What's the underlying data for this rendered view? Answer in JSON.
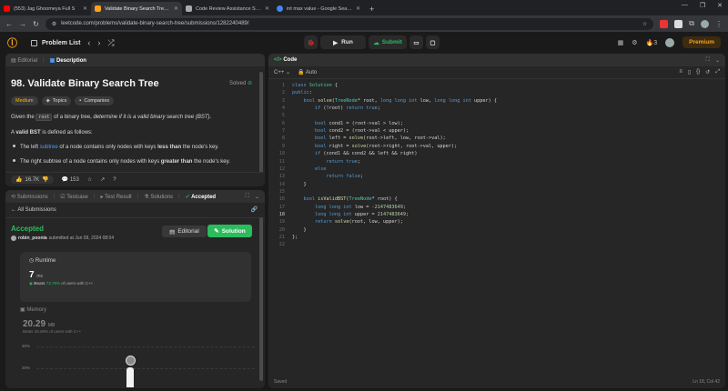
{
  "browser": {
    "tabs": [
      {
        "title": "(553) Jag Ghoomeya Full S",
        "color": "#ff0000"
      },
      {
        "title": "Validate Binary Search Tree - Le",
        "color": "#ffa116"
      },
      {
        "title": "Code Review Assistance System",
        "color": "#aaaaaa"
      },
      {
        "title": "int max value - Google Search",
        "color": "#4285f4"
      }
    ],
    "url": "leetcode.com/problems/validate-binary-search-tree/submissions/1282240489/"
  },
  "header": {
    "problem_list": "Problem List",
    "run": "Run",
    "submit": "Submit",
    "streak": "3",
    "premium": "Premium"
  },
  "description": {
    "tab_editorial": "Editorial",
    "tab_description": "Description",
    "title": "98. Validate Binary Search Tree",
    "solved": "Solved",
    "tags": [
      "Medium",
      "Topics",
      "Companies"
    ],
    "p1_pre": "Given the ",
    "p1_code": "root",
    "p1_mid": " of a binary tree, ",
    "p1_em": "determine if it is a valid binary search tree (BST)",
    "p1_post": ".",
    "p2_pre": "A ",
    "p2_b": "valid BST",
    "p2_post": " is defined as follows:",
    "b1_pre": "The left ",
    "b1_link": "subtree",
    "b1_mid": " of a node contains only nodes with keys ",
    "b1_b": "less than",
    "b1_post": " the node's key.",
    "b2_pre": "The right subtree of a node contains only nodes with keys ",
    "b2_b": "greater than",
    "b2_post": " the node's key.",
    "likes": "16.7K",
    "comments": "153"
  },
  "submission": {
    "tabs": [
      "Submissions",
      "Testcase",
      "Test Result",
      "Solutions",
      "Accepted"
    ],
    "all_submissions": "All Submissions",
    "status": "Accepted",
    "author": "robin_poonia",
    "submitted": "submitted at Jun 09, 2024 08:04",
    "editorial_btn": "Editorial",
    "solution_btn": "Solution",
    "runtime_label": "Runtime",
    "runtime_value": "7",
    "runtime_unit": "ms",
    "runtime_beats": "Beats",
    "runtime_pct": "73.78%",
    "runtime_suffix": "of users with C++",
    "memory_label": "Memory",
    "memory_value": "20.29",
    "memory_unit": "MB",
    "memory_beats": "Beats 29.08% of users with C++",
    "grid": [
      "30%",
      "20%"
    ]
  },
  "code": {
    "tab": "Code",
    "lang": "C++",
    "mode": "Auto",
    "saved": "Saved",
    "cursor": "Ln 18, Col 42",
    "lines": [
      "class Solution {",
      "public:",
      "    bool solve(TreeNode* root, long long int low, long long int upper) {",
      "        if (!root) return true;",
      "",
      "        bool cond1 = (root->val > low);",
      "        bool cond2 = (root->val < upper);",
      "        bool left = solve(root->left, low, root->val);",
      "        bool right = solve(root->right, root->val, upper);",
      "        if (cond1 && cond2 && left && right)",
      "            return true;",
      "        else",
      "            return false;",
      "    }",
      "",
      "    bool isValidBST(TreeNode* root) {",
      "        long long int low = -2147483649;",
      "        long long int upper = 2147483649;",
      "        return solve(root, low, upper);",
      "    }",
      "};",
      ""
    ]
  }
}
